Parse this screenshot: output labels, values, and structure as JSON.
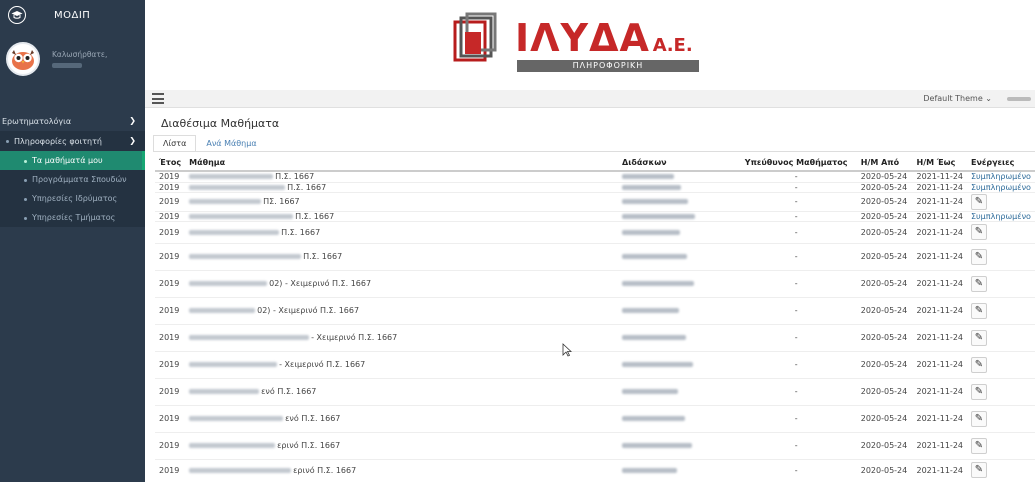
{
  "sidebar": {
    "brand_title": "ΜΟΔΙΠ",
    "user_greeting": "Καλωσήρθατε,",
    "menu": [
      {
        "label": "Ερωτηματολόγια",
        "chevron": "chevron-down-icon"
      },
      {
        "label": "Πληροφορίες φοιτητή",
        "chevron": "chevron-down-icon"
      }
    ],
    "submenu": [
      {
        "label": "Τα μαθήματά μου",
        "active": true
      },
      {
        "label": "Προγράμματα Σπουδών"
      },
      {
        "label": "Υπηρεσίες Ιδρύματος"
      },
      {
        "label": "Υπηρεσίες Τμήματος"
      }
    ]
  },
  "header": {
    "logo_text": "ΙΛΥΔΑ",
    "logo_suffix": "Α.Ε.",
    "logo_band": "ΠΛΗΡΟΦΟΡΙΚΗ"
  },
  "toolbar": {
    "theme_label": "Default Theme ⌄"
  },
  "main": {
    "title": "Διαθέσιμα Μαθήματα",
    "tabs": [
      {
        "label": "Λίστα",
        "active": true
      },
      {
        "label": "Ανά Μάθημα",
        "active": false
      }
    ],
    "columns": [
      "Έτος",
      "Μάθημα",
      "Διδάσκων",
      "Υπεύθυνος Μαθήματος",
      "Η/Μ Από",
      "Η/Μ Έως",
      "Ενέργειες"
    ],
    "rows": [
      {
        "year": "2019",
        "course_visible": "Π.Σ. 1667",
        "resp": "-",
        "from": "2020-05-24",
        "to": "2021-11-24",
        "action": "Συμπληρωμένο",
        "h": 11
      },
      {
        "year": "2019",
        "course_visible": "Π.Σ. 1667",
        "resp": "-",
        "from": "2020-05-24",
        "to": "2021-11-24",
        "action": "Συμπληρωμένο",
        "h": 10
      },
      {
        "year": "2019",
        "course_visible": "ΠΣ. 1667",
        "resp": "-",
        "from": "2020-05-24",
        "to": "2021-11-24",
        "action": "",
        "h": 19
      },
      {
        "year": "2019",
        "course_visible": "Π.Σ. 1667",
        "resp": "-",
        "from": "2020-05-24",
        "to": "2021-11-24",
        "action": "Συμπληρωμένο",
        "h": 10
      },
      {
        "year": "2019",
        "course_visible": "Π.Σ. 1667",
        "resp": "-",
        "from": "2020-05-24",
        "to": "2021-11-24",
        "action": "",
        "h": 22
      },
      {
        "year": "2019",
        "course_visible": "Π.Σ. 1667",
        "resp": "-",
        "from": "2020-05-24",
        "to": "2021-11-24",
        "action": "",
        "h": 27
      },
      {
        "year": "2019",
        "course_visible": "02) - Χειμερινό Π.Σ. 1667",
        "resp": "-",
        "from": "2020-05-24",
        "to": "2021-11-24",
        "action": "",
        "h": 27
      },
      {
        "year": "2019",
        "course_visible": "02) - Χειμερινό Π.Σ. 1667",
        "resp": "-",
        "from": "2020-05-24",
        "to": "2021-11-24",
        "action": "",
        "h": 27
      },
      {
        "year": "2019",
        "course_visible": "- Χειμερινό Π.Σ. 1667",
        "resp": "-",
        "from": "2020-05-24",
        "to": "2021-11-24",
        "action": "",
        "h": 27
      },
      {
        "year": "2019",
        "course_visible": "- Χειμερινό Π.Σ. 1667",
        "resp": "-",
        "from": "2020-05-24",
        "to": "2021-11-24",
        "action": "",
        "h": 27
      },
      {
        "year": "2019",
        "course_visible": "ενό Π.Σ. 1667",
        "resp": "-",
        "from": "2020-05-24",
        "to": "2021-11-24",
        "action": "",
        "h": 27
      },
      {
        "year": "2019",
        "course_visible": "ενό Π.Σ. 1667",
        "resp": "-",
        "from": "2020-05-24",
        "to": "2021-11-24",
        "action": "",
        "h": 27
      },
      {
        "year": "2019",
        "course_visible": "ερινό Π.Σ. 1667",
        "resp": "-",
        "from": "2020-05-24",
        "to": "2021-11-24",
        "action": "",
        "h": 27
      },
      {
        "year": "2019",
        "course_visible": "ερινό Π.Σ. 1667",
        "resp": "-",
        "from": "2020-05-24",
        "to": "2021-11-24",
        "action": "",
        "h": 22
      }
    ]
  },
  "colors": {
    "sidebar_bg": "#2c3b4c",
    "active_item": "#1f8a70",
    "brand_red": "#c62828",
    "link": "#4a80b3"
  }
}
